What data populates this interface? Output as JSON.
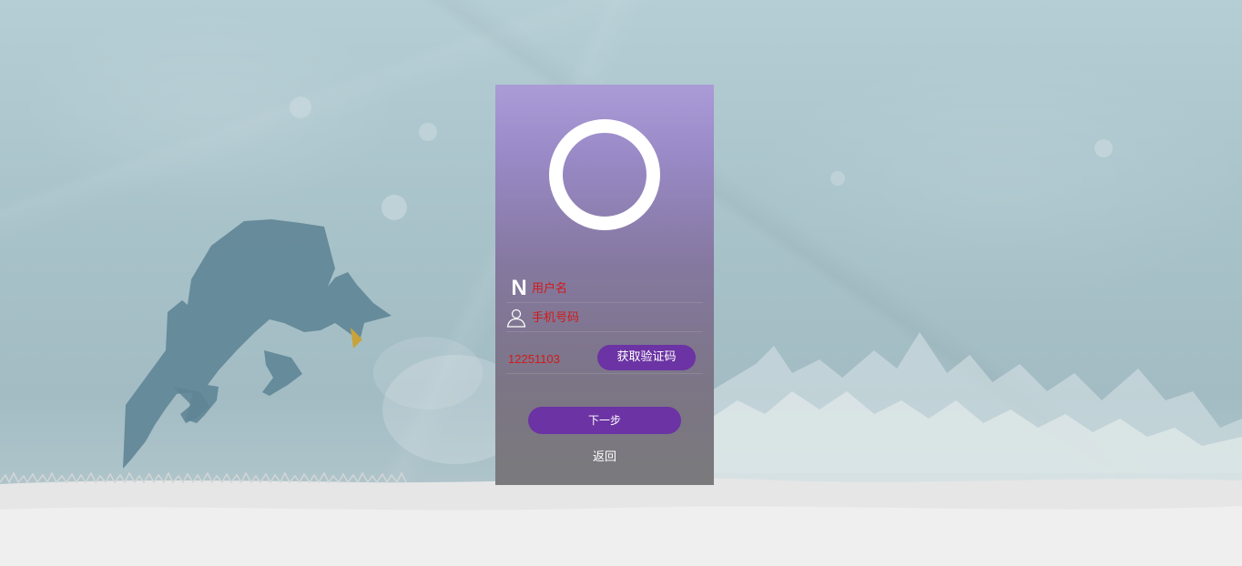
{
  "login": {
    "username_placeholder": "用户名",
    "phone_placeholder": "手机号码",
    "code_value": "12251103",
    "get_code_label": "获取验证码",
    "next_label": "下一步",
    "back_label": "返回",
    "username_icon_glyph": "N"
  },
  "icons": {
    "username": "letter-n-icon",
    "phone": "person-icon"
  },
  "colors": {
    "accent": "#6b33a3",
    "placeholder_text": "#d11a1a",
    "panel_top": "#ab9bd7",
    "panel_bottom": "#7a7a7c",
    "background": "#a9c4cc",
    "snow": "#e4e4e4",
    "dragon": "#5f8596"
  }
}
